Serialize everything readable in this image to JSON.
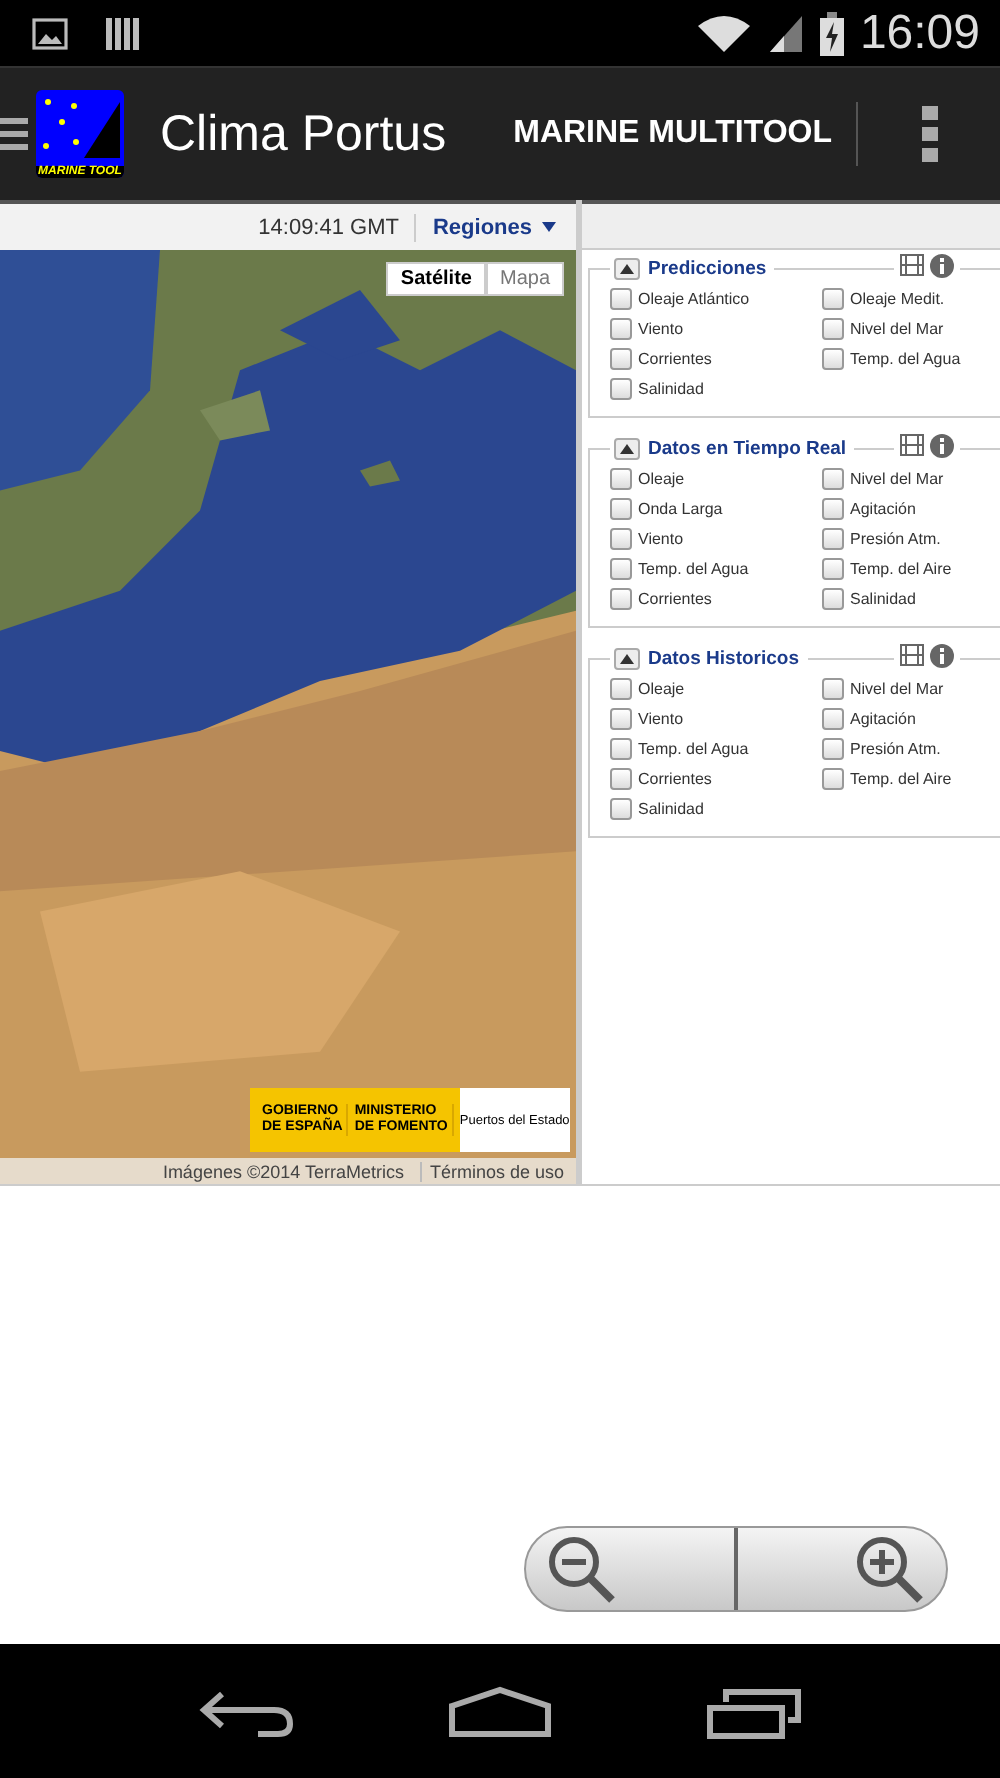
{
  "status_bar": {
    "time": "16:09"
  },
  "app_bar": {
    "logo_text": "MARINE TOOL",
    "title": "Clima Portus",
    "subtitle": "MARINE MULTITOOL"
  },
  "map": {
    "time": "14:09:41 GMT",
    "regions_label": "Regiones",
    "map_types": [
      {
        "label": "Satélite",
        "selected": true
      },
      {
        "label": "Mapa",
        "selected": false
      }
    ],
    "sponsor": {
      "gov_line1": "GOBIERNO",
      "gov_line2": "DE ESPAÑA",
      "min_line1": "MINISTERIO",
      "min_line2": "DE FOMENTO",
      "agency": "Puertos del Estado"
    },
    "attribution": "Imágenes ©2014 TerraMetrics",
    "terms": "Términos de uso"
  },
  "panels": [
    {
      "title": "Predicciones",
      "options": [
        {
          "label": "Oleaje Atlántico",
          "checked": false
        },
        {
          "label": "Oleaje Medit.",
          "checked": false
        },
        {
          "label": "Viento",
          "checked": false
        },
        {
          "label": "Nivel del Mar",
          "checked": false
        },
        {
          "label": "Corrientes",
          "checked": false
        },
        {
          "label": "Temp. del Agua",
          "checked": false
        },
        {
          "label": "Salinidad",
          "checked": false
        }
      ]
    },
    {
      "title": "Datos en Tiempo Real",
      "options": [
        {
          "label": "Oleaje",
          "checked": false
        },
        {
          "label": "Nivel del Mar",
          "checked": false
        },
        {
          "label": "Onda Larga",
          "checked": false
        },
        {
          "label": "Agitación",
          "checked": false
        },
        {
          "label": "Viento",
          "checked": false
        },
        {
          "label": "Presión Atm.",
          "checked": false
        },
        {
          "label": "Temp. del Agua",
          "checked": false
        },
        {
          "label": "Temp. del Aire",
          "checked": false
        },
        {
          "label": "Corrientes",
          "checked": false
        },
        {
          "label": "Salinidad",
          "checked": false
        }
      ]
    },
    {
      "title": "Datos Historicos",
      "options": [
        {
          "label": "Oleaje",
          "checked": false
        },
        {
          "label": "Nivel del Mar",
          "checked": false
        },
        {
          "label": "Viento",
          "checked": false
        },
        {
          "label": "Agitación",
          "checked": false
        },
        {
          "label": "Temp. del Agua",
          "checked": false
        },
        {
          "label": "Presión Atm.",
          "checked": false
        },
        {
          "label": "Corrientes",
          "checked": false
        },
        {
          "label": "Temp. del Aire",
          "checked": false
        },
        {
          "label": "Salinidad",
          "checked": false
        }
      ]
    }
  ]
}
